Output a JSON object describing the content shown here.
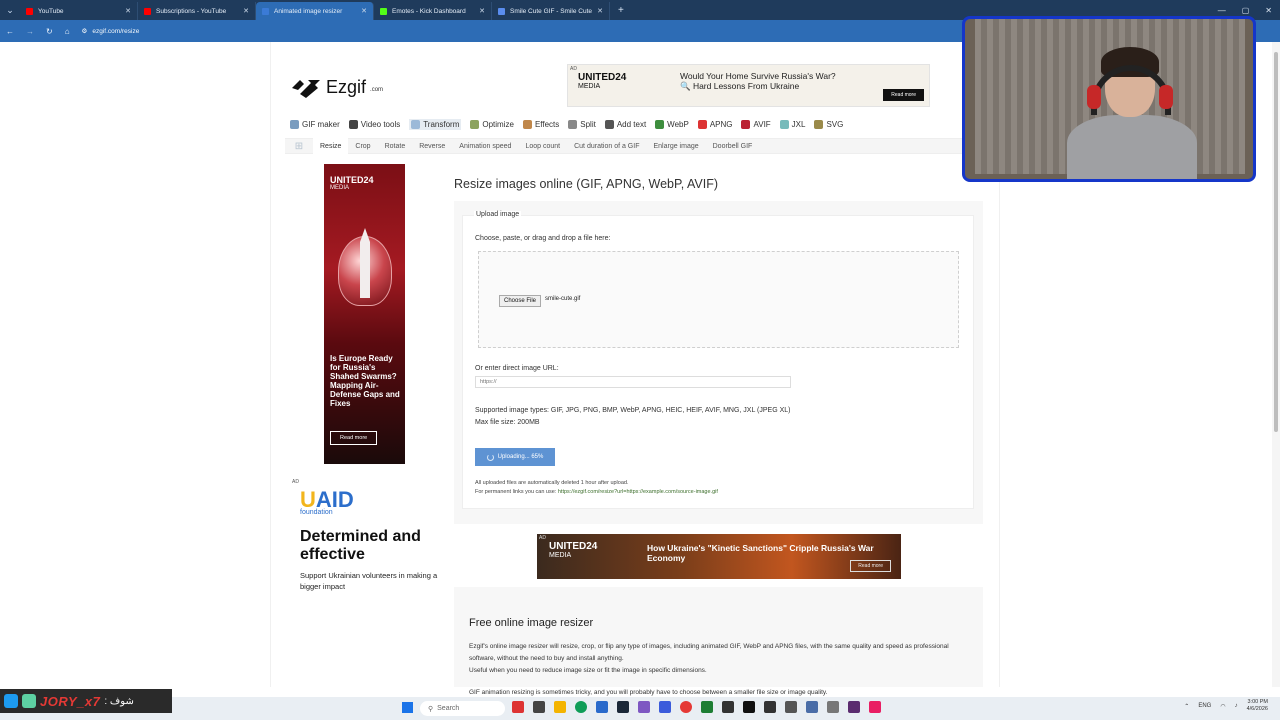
{
  "browser": {
    "tabs": [
      {
        "title": "YouTube",
        "color": "#ff0000"
      },
      {
        "title": "Subscriptions - YouTube",
        "color": "#ff0000"
      },
      {
        "title": "Animated image resizer",
        "color": "#3b7bd6",
        "active": true
      },
      {
        "title": "Emotes - Kick Dashboard",
        "color": "#53fc18"
      },
      {
        "title": "Smile Cute GIF - Smile Cute Pe",
        "color": "#5a8dee"
      }
    ],
    "url": "ezgif.com/resize"
  },
  "site": {
    "logo": "Ezgif",
    "logo_suffix": ".com",
    "menu": [
      {
        "label": "GIF maker",
        "color": "#7a9cbf"
      },
      {
        "label": "Video tools",
        "color": "#444"
      },
      {
        "label": "Transform",
        "color": "#9cb9d8",
        "active": true
      },
      {
        "label": "Optimize",
        "color": "#8ca35e"
      },
      {
        "label": "Effects",
        "color": "#c0874a"
      },
      {
        "label": "Split",
        "color": "#888"
      },
      {
        "label": "Add text",
        "color": "#555"
      },
      {
        "label": "WebP",
        "color": "#3e8e3e"
      },
      {
        "label": "APNG",
        "color": "#d33"
      },
      {
        "label": "AVIF",
        "color": "#b23"
      },
      {
        "label": "JXL",
        "color": "#7bb"
      },
      {
        "label": "SVG",
        "color": "#9a8a4a"
      }
    ],
    "submenu": [
      "Resize",
      "Crop",
      "Rotate",
      "Reverse",
      "Animation speed",
      "Loop count",
      "Cut duration of a GIF",
      "Enlarge image",
      "Doorbell GIF"
    ]
  },
  "ads": {
    "top": {
      "tag": "AD",
      "brand": "UNITED24",
      "brand_sub": "MEDIA",
      "text": "Would Your Home Survive Russia's War? 🔍 Hard Lessons From Ukraine",
      "button": "Read more"
    },
    "side": {
      "brand": "UNITED24",
      "brand_sub": "MEDIA",
      "text": "Is Europe Ready for Russia's Shahed Swarms? Mapping Air-Defense Gaps and Fixes",
      "button": "Read more"
    },
    "uaid": {
      "tag": "AD",
      "logo_u": "U",
      "logo_rest": "AID",
      "logo_sub": "foundation",
      "headline": "Determined and effective",
      "sub": "Support Ukrainian volunteers in making a bigger impact"
    },
    "mid": {
      "tag": "AD",
      "brand": "UNITED24",
      "brand_sub": "MEDIA",
      "text": "How Ukraine's \"Kinetic Sanctions\" Cripple Russia's War Economy",
      "button": "Read more"
    }
  },
  "main": {
    "title": "Resize images online (GIF, APNG, WebP, AVIF)",
    "upload_legend": "Upload image",
    "drop_label": "Choose, paste, or drag and drop a file here:",
    "file_button": "Choose File",
    "file_name": "smile-cute.gif",
    "url_label": "Or enter direct image URL:",
    "url_placeholder": "https://",
    "supported": "Supported image types: GIF, JPG, PNG, BMP, WebP, APNG, HEIC, HEIF, AVIF, MNG, JXL (JPEG XL)",
    "max_size": "Max file size: 200MB",
    "upload_button": "Uploading... 65%",
    "upload_progress": 0.65,
    "note1": "All uploaded files are automatically deleted 1 hour after upload.",
    "note2_prefix": "For permanent links you can use: ",
    "note2_link": "https://ezgif.com/resize?url=https://example.com/source-image.gif",
    "free_title": "Free online image resizer",
    "free_p1": "Ezgif's online image resizer will resize, crop, or flip any type of images, including animated GIF, WebP and APNG files, with the same quality and speed as professional software, without the need to buy and install anything.",
    "free_p2": "Useful when you need to reduce image size or fit the image in specific dimensions.",
    "free_p3": "GIF animation resizing is sometimes tricky, and you will probably have to choose between a smaller file size or image quality."
  },
  "overlay": {
    "streamer_name": "JORY_x7",
    "arabic_label": ": شوف"
  },
  "taskbar": {
    "search": "Search",
    "lang": "ENG",
    "time": "3:00 PM",
    "date": "4/6/2026"
  }
}
